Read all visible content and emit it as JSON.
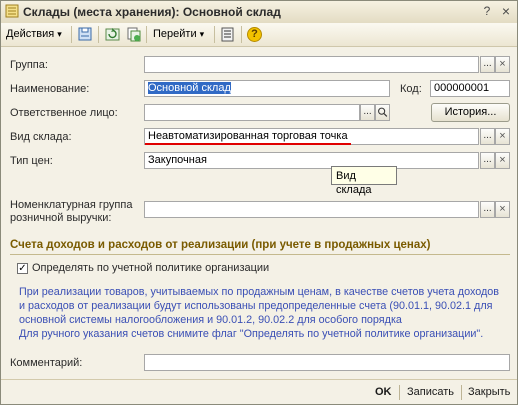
{
  "window": {
    "title": "Склады (места хранения): Основной склад",
    "controls": {
      "help": "?",
      "close": "×"
    }
  },
  "toolbar": {
    "actions_label": "Действия",
    "goto_label": "Перейти",
    "help_symbol": "?"
  },
  "form": {
    "group": {
      "label": "Группа:",
      "value": ""
    },
    "name": {
      "label": "Наименование:",
      "value": "Основной склад"
    },
    "code": {
      "label": "Код:",
      "value": "000000001"
    },
    "responsible": {
      "label": "Ответственное лицо:",
      "value": ""
    },
    "history_button": "История...",
    "warehouse_type": {
      "label": "Вид склада:",
      "value": "Неавтоматизированная торговая точка"
    },
    "price_type": {
      "label": "Тип цен:",
      "value": "Закупочная"
    },
    "nomenclature_group": {
      "label_line1": "Номенклатурная группа",
      "label_line2": "розничной выручки:",
      "value": ""
    },
    "tooltip": "Вид склада",
    "section_title": "Счета доходов и расходов от реализации (при учете в продажных ценах)",
    "policy_checkbox": {
      "label": "Определять по учетной политике организации",
      "checked": true
    },
    "info_line1": "При реализации товаров, учитываемых по продажным ценам, в качестве счетов учета доходов",
    "info_line2": "и расходов от реализации будут использованы предопределенные счета (90.01.1, 90.02.1 для",
    "info_line3": "основной системы налогообложения и 90.01.2, 90.02.2 для особого порядка",
    "info_line4": "Для ручного указания счетов снимите флаг \"Определять по учетной политике организации\".",
    "comment": {
      "label": "Комментарий:",
      "value": ""
    }
  },
  "footer": {
    "ok": "OK",
    "save": "Записать",
    "close": "Закрыть"
  },
  "select_symbol": "...",
  "clear_symbol": "×",
  "dropdown_symbol": "▾",
  "colors": {
    "accent_link": "#3a4fb5",
    "section": "#7a5b00",
    "selection": "#316ac5",
    "underline": "#e00000"
  }
}
